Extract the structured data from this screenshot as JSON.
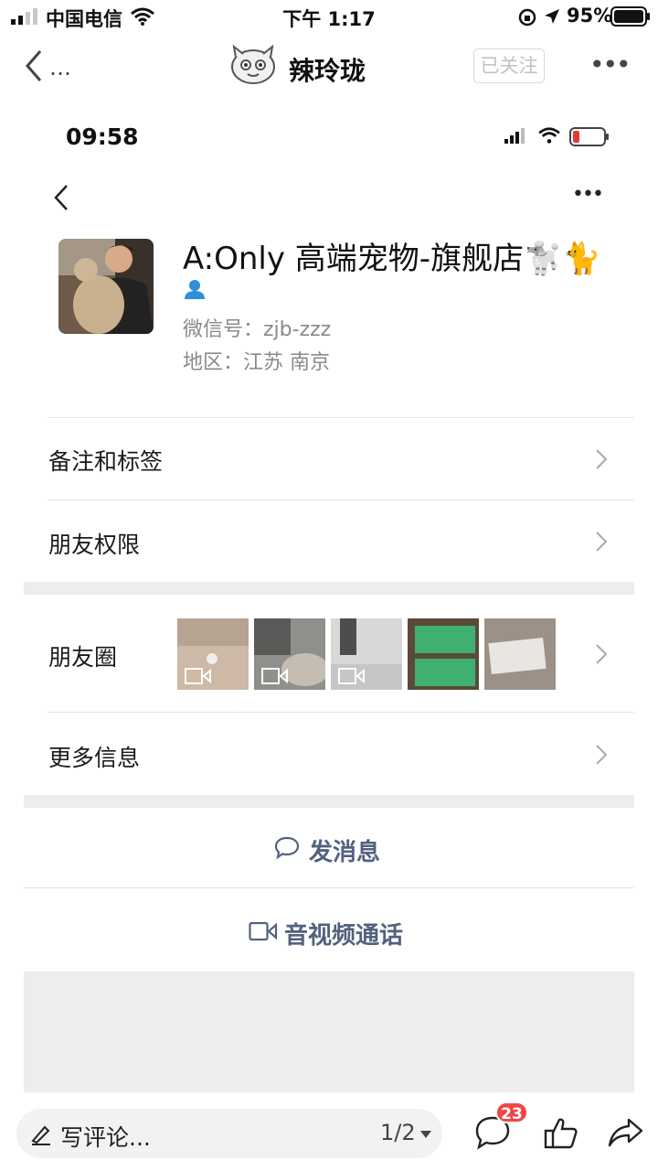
{
  "status_bar": {
    "carrier": "中国电信",
    "time": "下午 1:17",
    "battery_text": "95%"
  },
  "nav": {
    "back_dots": "…",
    "title": "辣玲珑",
    "follow_label": "已关注",
    "more": "•••"
  },
  "screenshot": {
    "status_time": "09:58",
    "more": "•••",
    "profile": {
      "name": "A:Only 高端宠物-旗舰店🐩🐈",
      "wechat_id": "微信号：zjb-zzz",
      "region": "地区：江苏 南京"
    },
    "rows": {
      "notes_tags": "备注和标签",
      "friend_perms": "朋友权限",
      "moments": "朋友圈",
      "more_info": "更多信息"
    },
    "actions": {
      "message": "发消息",
      "call": "音视频通话"
    }
  },
  "bottom_bar": {
    "comment_placeholder": "写评论...",
    "page_indicator": "1/2",
    "comment_count": "23"
  },
  "colors": {
    "action_text": "#51627e",
    "badge": "#f04646",
    "divider": "#e5e5e5",
    "section_gap": "#ededed"
  }
}
